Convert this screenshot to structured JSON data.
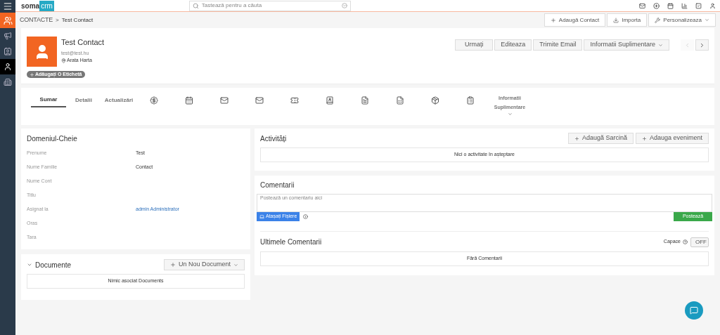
{
  "logo": {
    "part_1": "soma",
    "part_2": "crm"
  },
  "search": {
    "placeholder": "Tastează pentru a căuta"
  },
  "sidebar": {
    "items": [
      {
        "selected": false
      },
      {
        "selected": false
      },
      {
        "selected": true
      },
      {
        "selected": false
      }
    ]
  },
  "breadcrumb": {
    "section": "CONTACTE",
    "separator": ">",
    "current": "Test Contact"
  },
  "header_buttons": [
    "Adaugă Contact",
    "Importa",
    "Personalizeaza"
  ],
  "contact": {
    "name": "Test Contact",
    "email": "test@test.hu",
    "map_link": "Arata Harta",
    "tag_button": "Adăugați O Etichetă"
  },
  "actions": [
    "Urmați",
    "Editeaza",
    "Trimite Email",
    "Informatii Suplimentare"
  ],
  "pager": {
    "prev_disabled": true,
    "next_disabled": false
  },
  "tabs": [
    {
      "kind": "text",
      "label": "Sumar",
      "selected": true
    },
    {
      "kind": "text",
      "label": "Detalii",
      "selected": false
    },
    {
      "kind": "text",
      "label": "Actualizări",
      "selected": false
    },
    {
      "kind": "icon",
      "selected": false
    },
    {
      "kind": "icon",
      "selected": false
    },
    {
      "kind": "icon",
      "selected": false
    },
    {
      "kind": "icon",
      "selected": false
    },
    {
      "kind": "icon",
      "selected": false
    },
    {
      "kind": "icon",
      "selected": false
    },
    {
      "kind": "icon",
      "selected": false
    },
    {
      "kind": "icon",
      "selected": false
    },
    {
      "kind": "icon",
      "selected": false
    },
    {
      "kind": "icon",
      "selected": false
    },
    {
      "kind": "dropdown",
      "label": "Informatii Suplimentare",
      "selected": false
    }
  ],
  "key_fields": {
    "title": "Domeniul-Cheie",
    "rows": [
      {
        "label": "Prenume",
        "value": "Test",
        "link": false
      },
      {
        "label": "Nume Familie",
        "value": "Contact",
        "link": false
      },
      {
        "label": "Nume Cont"
      },
      {
        "label": "Titlu"
      },
      {
        "label": "Asignat la",
        "value": "admin Administrator",
        "link": true
      },
      {
        "label": "Oras"
      },
      {
        "label": "Tara"
      }
    ]
  },
  "documents": {
    "title": "Documente",
    "expanded": true,
    "button": "Un Nou Document",
    "empty": "Nimic asociat Documents"
  },
  "activities": {
    "title": "Activități",
    "buttons": [
      "Adaugă Sarcină",
      "Adauga eveniment"
    ],
    "empty": "Nici o activitate în așteptare"
  },
  "comments": {
    "title": "Comentarii",
    "placeholder": "Postează un comentariu aici",
    "attach": "Atașați Fișiere",
    "post": "Postează"
  },
  "latest_comments": {
    "title": "Ultimele Comentarii",
    "caps_label": "Capace",
    "caps_toggle": {
      "on": false,
      "label": "OFF"
    },
    "empty": "Fără Comentarii"
  }
}
